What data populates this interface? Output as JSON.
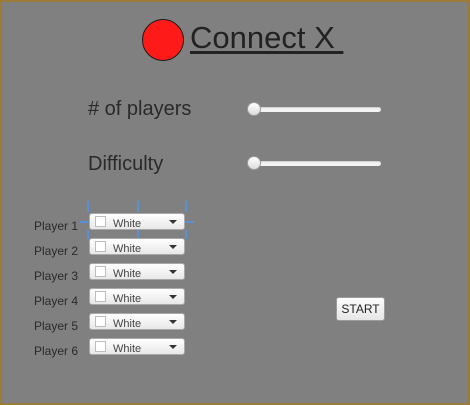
{
  "header": {
    "title": "Connect X ",
    "logo_color": "#ff1a1a"
  },
  "settings": {
    "players_label": "# of players",
    "players_value": 0,
    "difficulty_label": "Difficulty",
    "difficulty_value": 0
  },
  "players": [
    {
      "label": "Player 1",
      "color_name": "White",
      "color": "#ffffff",
      "focused": true
    },
    {
      "label": "Player 2",
      "color_name": "White",
      "color": "#ffffff"
    },
    {
      "label": "Player 3",
      "color_name": "White",
      "color": "#ffffff"
    },
    {
      "label": "Player 4",
      "color_name": "White",
      "color": "#ffffff"
    },
    {
      "label": "Player 5",
      "color_name": "White",
      "color": "#ffffff"
    },
    {
      "label": "Player 6",
      "color_name": "White",
      "color": "#ffffff"
    }
  ],
  "actions": {
    "start_label": "START"
  },
  "colors": {
    "background": "#808080",
    "border": "#9a7b3a",
    "focus": "#5b8fd6"
  }
}
